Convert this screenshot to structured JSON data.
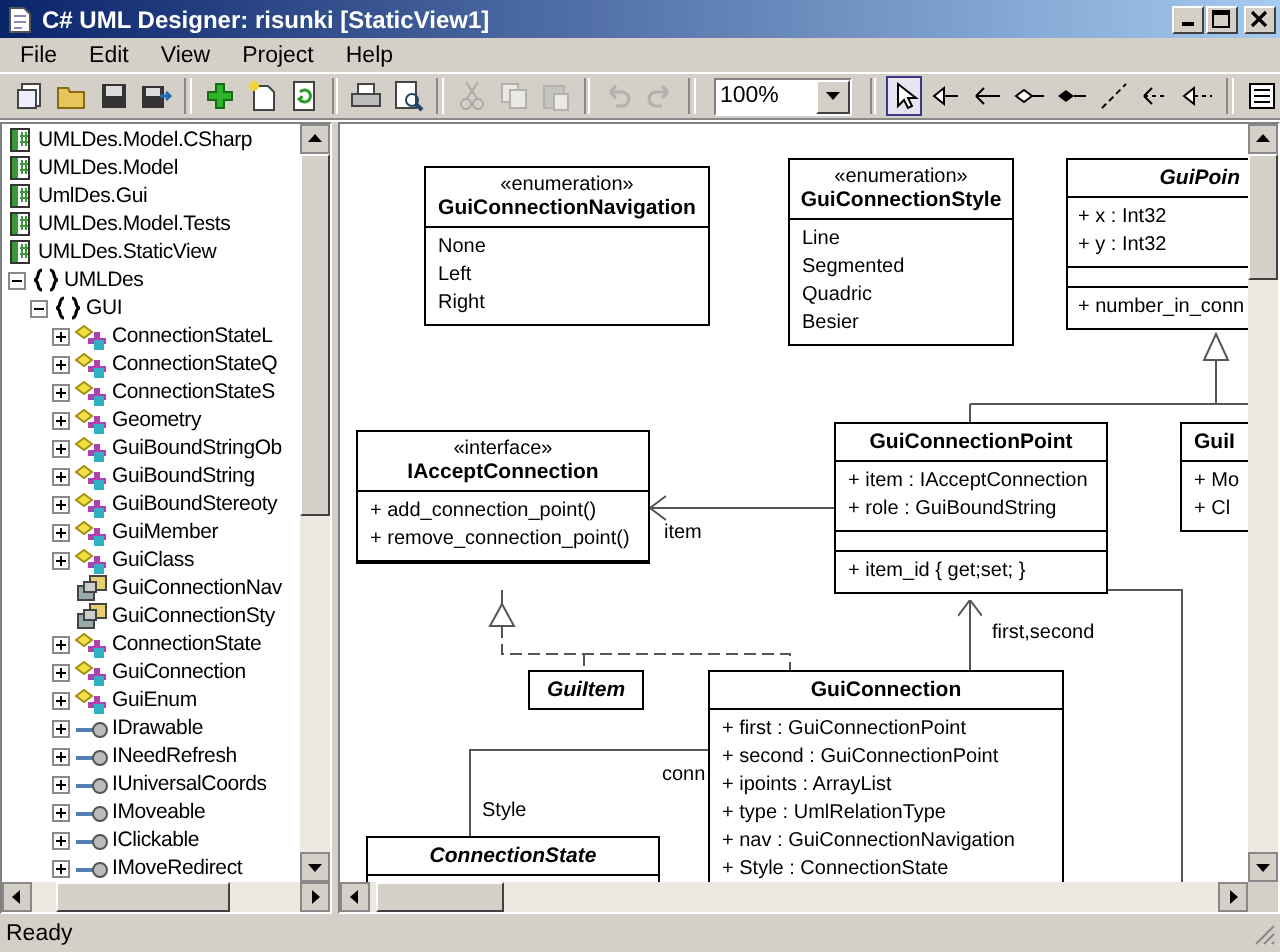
{
  "window": {
    "title": "C# UML Designer: risunki [StaticView1]"
  },
  "menu": [
    "File",
    "Edit",
    "View",
    "Project",
    "Help"
  ],
  "toolbar": [
    {
      "kind": "button",
      "disabled": false
    },
    {
      "kind": "button",
      "disabled": false
    },
    {
      "kind": "button",
      "disabled": false
    },
    {
      "kind": "button",
      "disabled": false
    },
    {
      "kind": "separator"
    },
    {
      "kind": "button",
      "disabled": false
    },
    {
      "kind": "button",
      "disabled": false
    },
    {
      "kind": "button",
      "disabled": false
    },
    {
      "kind": "separator"
    },
    {
      "kind": "button",
      "disabled": false
    },
    {
      "kind": "button",
      "disabled": false
    },
    {
      "kind": "separator"
    },
    {
      "kind": "button",
      "disabled": true
    },
    {
      "kind": "button",
      "disabled": true
    },
    {
      "kind": "button",
      "disabled": true
    },
    {
      "kind": "separator"
    },
    {
      "kind": "button",
      "disabled": true
    },
    {
      "kind": "button",
      "disabled": true
    },
    {
      "kind": "separator"
    },
    {
      "kind": "combo",
      "value": "100%"
    },
    {
      "kind": "separator"
    },
    {
      "kind": "tool",
      "selected": true
    },
    {
      "kind": "tool",
      "selected": false
    },
    {
      "kind": "tool",
      "selected": false
    },
    {
      "kind": "tool",
      "selected": false
    },
    {
      "kind": "tool",
      "selected": false
    },
    {
      "kind": "tool",
      "selected": false
    },
    {
      "kind": "tool",
      "selected": false
    },
    {
      "kind": "tool",
      "selected": false
    },
    {
      "kind": "separator"
    },
    {
      "kind": "button",
      "disabled": false
    }
  ],
  "tree": [
    {
      "kind": "project",
      "label": "UMLDes.Model.CSharp"
    },
    {
      "kind": "project",
      "label": "UMLDes.Model"
    },
    {
      "kind": "project",
      "label": "UmlDes.Gui"
    },
    {
      "kind": "project",
      "label": "UMLDes.Model.Tests"
    },
    {
      "kind": "project",
      "label": "UMLDes.StaticView"
    },
    {
      "kind": "namespace",
      "label": "UMLDes",
      "expanded": true,
      "children": [
        {
          "kind": "namespace",
          "label": "GUI",
          "expanded": true,
          "children": [
            {
              "kind": "class",
              "label": "ConnectionStateL",
              "expanded": false
            },
            {
              "kind": "class",
              "label": "ConnectionStateQ",
              "expanded": false
            },
            {
              "kind": "class",
              "label": "ConnectionStateS",
              "expanded": false
            },
            {
              "kind": "class",
              "label": "Geometry",
              "expanded": false
            },
            {
              "kind": "class",
              "label": "GuiBoundStringOb",
              "expanded": false
            },
            {
              "kind": "class",
              "label": "GuiBoundString",
              "expanded": false
            },
            {
              "kind": "class",
              "label": "GuiBoundStereoty",
              "expanded": false
            },
            {
              "kind": "class",
              "label": "GuiMember",
              "expanded": false
            },
            {
              "kind": "class",
              "label": "GuiClass",
              "expanded": false
            },
            {
              "kind": "enum",
              "label": "GuiConnectionNav"
            },
            {
              "kind": "enum",
              "label": "GuiConnectionSty"
            },
            {
              "kind": "class",
              "label": "ConnectionState",
              "expanded": false
            },
            {
              "kind": "class",
              "label": "GuiConnection",
              "expanded": false
            },
            {
              "kind": "class",
              "label": "GuiEnum",
              "expanded": false
            },
            {
              "kind": "interface",
              "label": "IDrawable",
              "expanded": false
            },
            {
              "kind": "interface",
              "label": "INeedRefresh",
              "expanded": false
            },
            {
              "kind": "interface",
              "label": "IUniversalCoords",
              "expanded": false
            },
            {
              "kind": "interface",
              "label": "IMoveable",
              "expanded": false
            },
            {
              "kind": "interface",
              "label": "IClickable",
              "expanded": false
            },
            {
              "kind": "interface",
              "label": "IMoveRedirect",
              "expanded": false
            }
          ]
        }
      ]
    }
  ],
  "diagram": {
    "classes": [
      {
        "stereotype": "«enumeration»",
        "name": "GuiConnectionNavigation",
        "abstract": false,
        "compartments": [
          {
            "kind": "list",
            "lines": [
              "None",
              "Left",
              "Right"
            ]
          }
        ]
      },
      {
        "stereotype": "«enumeration»",
        "name": "GuiConnectionStyle",
        "abstract": false,
        "compartments": [
          {
            "kind": "list",
            "lines": [
              "Line",
              "Segmented",
              "Quadric",
              "Besier"
            ]
          }
        ]
      },
      {
        "name": "GuiPoin",
        "abstract": true,
        "compartments": [
          {
            "kind": "list",
            "lines": [
              "+ x : Int32",
              "+ y : Int32"
            ]
          },
          {
            "kind": "empty"
          },
          {
            "kind": "list",
            "lines": [
              "+ number_in_conn"
            ]
          }
        ]
      },
      {
        "stereotype": "«interface»",
        "name": "IAcceptConnection",
        "abstract": false,
        "compartments": [
          {
            "kind": "list",
            "lines": [
              "+ add_connection_point()",
              "+ remove_connection_point()"
            ]
          },
          {
            "kind": "empty"
          }
        ]
      },
      {
        "name": "GuiConnectionPoint",
        "abstract": false,
        "compartments": [
          {
            "kind": "list",
            "lines": [
              "+ item : IAcceptConnection",
              "+ role : GuiBoundString"
            ]
          },
          {
            "kind": "empty"
          },
          {
            "kind": "list",
            "lines": [
              "+ item_id { get;set; }"
            ]
          }
        ]
      },
      {
        "name": "GuiI",
        "abstract": false,
        "compartments": [
          {
            "kind": "list",
            "lines": [
              "+ Mo",
              "+ Cl"
            ]
          }
        ]
      },
      {
        "name": "GuiItem",
        "abstract": true
      },
      {
        "name": "GuiConnection",
        "abstract": false,
        "compartments": [
          {
            "kind": "list",
            "lines": [
              "+ first : GuiConnectionPoint",
              "+ second : GuiConnectionPoint",
              "+ ipoints : ArrayList",
              "+ type : UmlRelationType",
              "+ nav : GuiConnectionNavigation",
              "+ Style : ConnectionState"
            ]
          }
        ]
      },
      {
        "name": "ConnectionState",
        "abstract": true,
        "compartments": [
          {
            "kind": "empty"
          }
        ]
      }
    ],
    "connectors": [
      {
        "kind": "generalization"
      },
      {
        "kind": "association",
        "label": "item"
      },
      {
        "kind": "realization"
      },
      {
        "kind": "association",
        "label": "first,second"
      },
      {
        "kind": "link",
        "labels": [
          "conn",
          "Style"
        ]
      },
      {
        "kind": "link"
      }
    ]
  },
  "status_bar": "Ready"
}
